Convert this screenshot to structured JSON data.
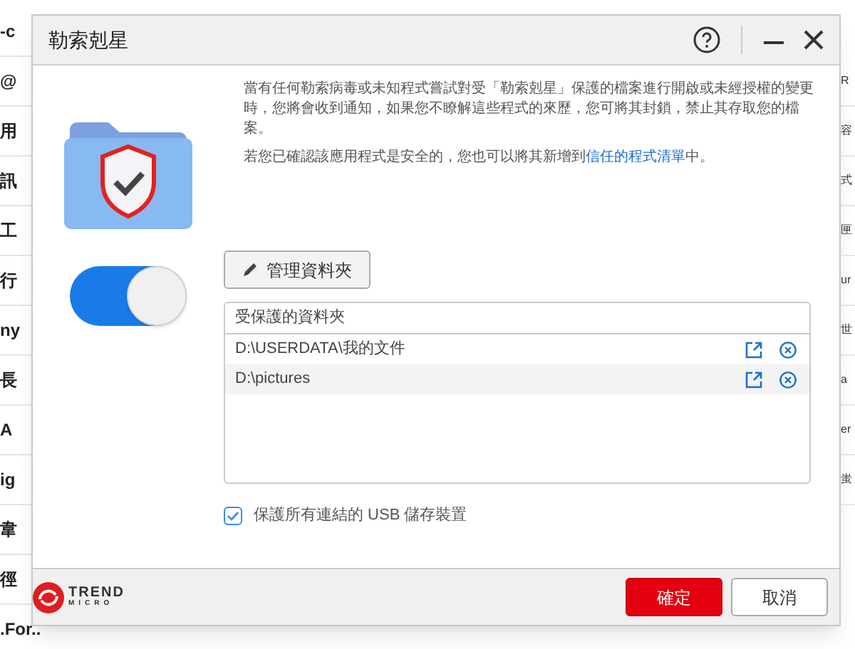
{
  "background": {
    "left_fragments": [
      "-c",
      "@",
      "用",
      "訊",
      "工",
      "行",
      "ny",
      "長",
      "A",
      "ig",
      "韋",
      "徑",
      ".For.."
    ],
    "right_fragments": [
      "R",
      "容",
      "式",
      "匣",
      "ur",
      "世",
      "a",
      "er",
      "蚩"
    ]
  },
  "window": {
    "title": "勒索剋星"
  },
  "description": "當有任何勒索病毒或未知程式嘗試對受「勒索剋星」保護的檔案進行開啟或未經授權的變更時，您將會收到通知，如果您不瞭解這些程式的來歷，您可將其封鎖，禁止其存取您的檔案。",
  "trusted_note": {
    "before": "若您已確認該應用程式是安全的，您也可以將其新增到",
    "link": "信任的程式清單",
    "after": "中。"
  },
  "protection_toggle": {
    "on": true
  },
  "manage_button": "管理資料夾",
  "folder_list": {
    "header": "受保護的資料夾",
    "rows": [
      {
        "path": "D:\\USERDATA\\我的文件",
        "selected": false
      },
      {
        "path": "D:\\pictures",
        "selected": true
      }
    ]
  },
  "usb_option": {
    "label": "保護所有連結的 USB 儲存裝置",
    "checked": true
  },
  "logo": {
    "line1": "TREND",
    "line2": "MICRO"
  },
  "buttons": [
    {
      "label": "確定",
      "kind": "primary"
    },
    {
      "label": "取消",
      "kind": "secondary"
    }
  ]
}
